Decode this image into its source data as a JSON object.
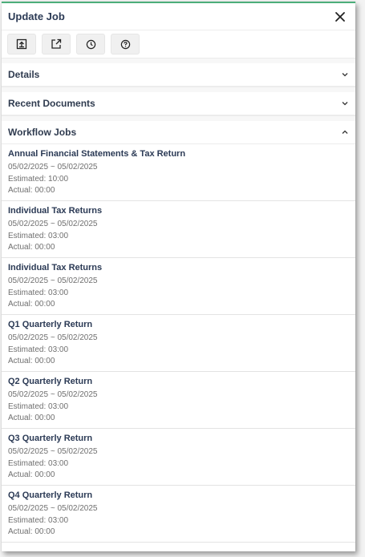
{
  "header": {
    "title": "Update Job",
    "close_icon": "close-icon"
  },
  "toolbar": {
    "buttons": [
      {
        "name": "upload-icon"
      },
      {
        "name": "open-external-icon"
      },
      {
        "name": "clock-icon"
      },
      {
        "name": "help-icon"
      }
    ]
  },
  "sections": {
    "details": {
      "title": "Details",
      "expanded": false
    },
    "recent_documents": {
      "title": "Recent Documents",
      "expanded": false
    },
    "workflow_jobs": {
      "title": "Workflow Jobs",
      "expanded": true
    }
  },
  "jobs": [
    {
      "name": "Annual Financial Statements & Tax Return",
      "dates": "05/02/2025 ~ 05/02/2025",
      "estimated": "Estimated: 10:00",
      "actual": "Actual: 00:00"
    },
    {
      "name": "Individual Tax Returns",
      "dates": "05/02/2025 ~ 05/02/2025",
      "estimated": "Estimated: 03:00",
      "actual": "Actual: 00:00"
    },
    {
      "name": "Individual Tax Returns",
      "dates": "05/02/2025 ~ 05/02/2025",
      "estimated": "Estimated: 03:00",
      "actual": "Actual: 00:00"
    },
    {
      "name": "Q1 Quarterly Return",
      "dates": "05/02/2025 ~ 05/02/2025",
      "estimated": "Estimated: 03:00",
      "actual": "Actual: 00:00"
    },
    {
      "name": "Q2 Quarterly Return",
      "dates": "05/02/2025 ~ 05/02/2025",
      "estimated": "Estimated: 03:00",
      "actual": "Actual: 00:00"
    },
    {
      "name": "Q3 Quarterly Return",
      "dates": "05/02/2025 ~ 05/02/2025",
      "estimated": "Estimated: 03:00",
      "actual": "Actual: 00:00"
    },
    {
      "name": "Q4 Quarterly Return",
      "dates": "05/02/2025 ~ 05/02/2025",
      "estimated": "Estimated: 03:00",
      "actual": "Actual: 00:00"
    }
  ],
  "colors": {
    "accent": "#4cae7a",
    "title": "#2b3a55",
    "muted": "#6f6f6f"
  }
}
